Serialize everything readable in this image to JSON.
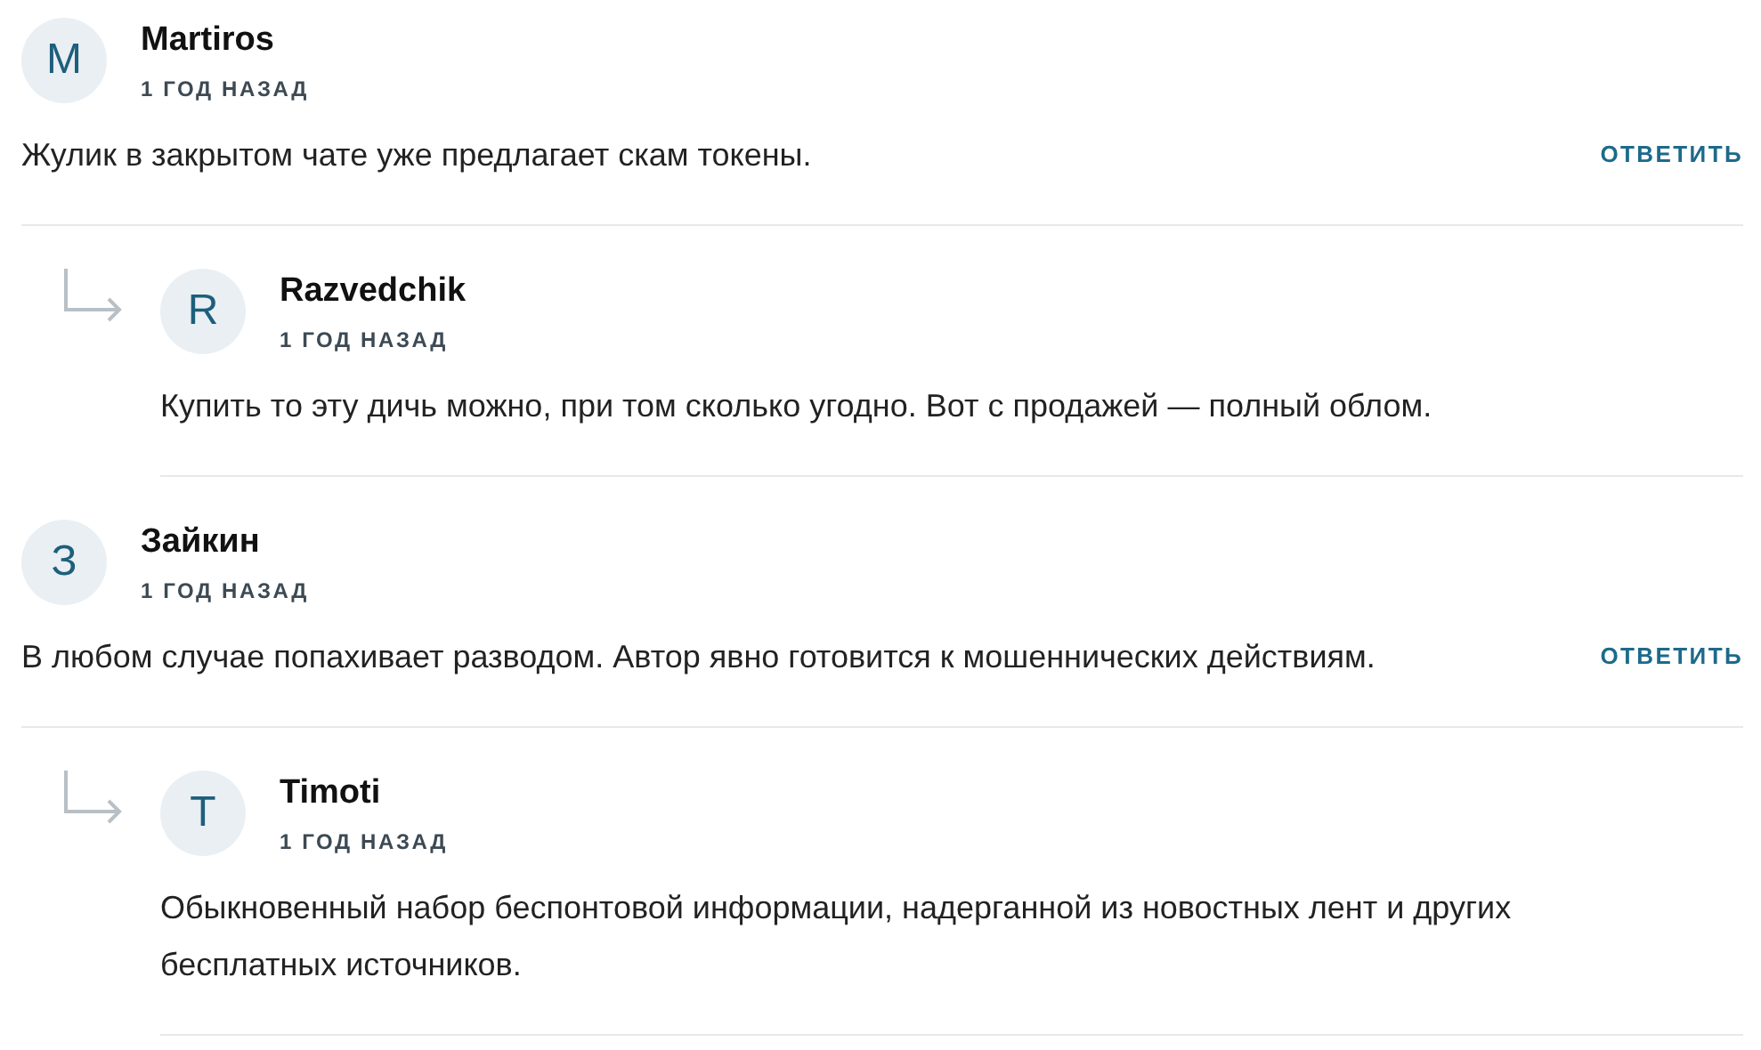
{
  "comments": [
    {
      "avatar_letter": "M",
      "author": "Martiros",
      "time": "1 ГОД НАЗАД",
      "text": "Жулик в закрытом чате уже предлагает скам токены.",
      "reply_button": "ОТВЕТИТЬ",
      "children": [
        {
          "avatar_letter": "R",
          "author": "Razvedchik",
          "time": "1 ГОД НАЗАД",
          "text": "Купить то эту дичь можно, при том сколько угодно. Вот с продажей — полный облом."
        }
      ]
    },
    {
      "avatar_letter": "З",
      "author": "Зайкин",
      "time": "1 ГОД НАЗАД",
      "text": "В любом случае попахивает разводом. Автор явно готовится к мошеннических действиям.",
      "reply_button": "ОТВЕТИТЬ",
      "children": [
        {
          "avatar_letter": "T",
          "author": "Timoti",
          "time": "1 ГОД НАЗАД",
          "text": "Обыкновенный набор беспонтовой информации, надерганной из новостных лент и других бесплатных источников."
        }
      ]
    }
  ]
}
